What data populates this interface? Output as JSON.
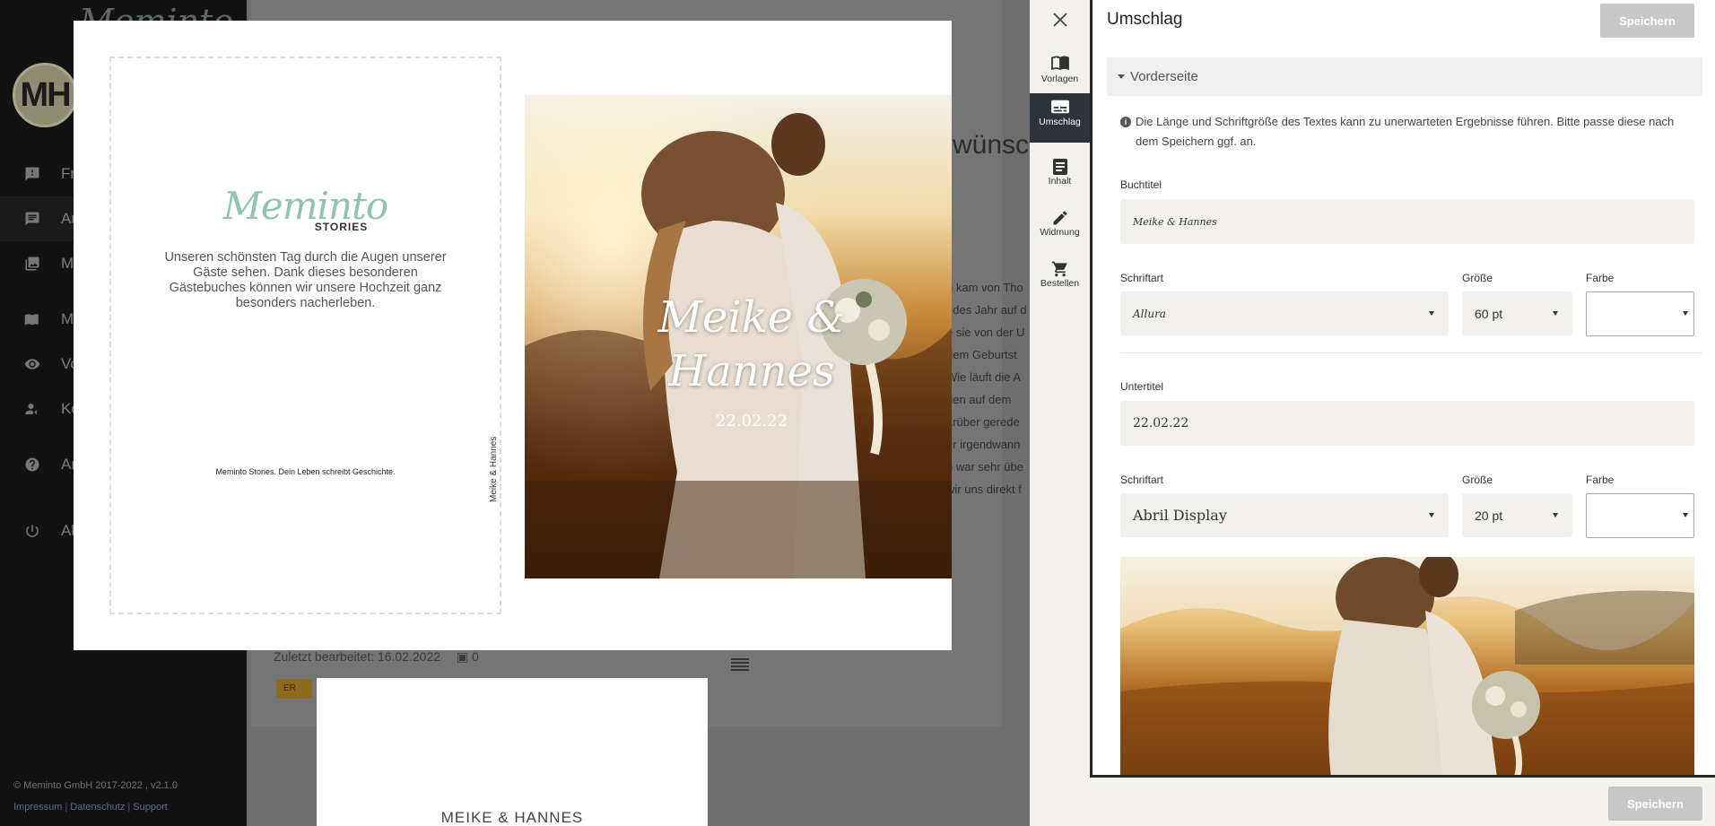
{
  "app_sidebar": {
    "logo_text": "Meminto",
    "avatar_initials": "MH",
    "nav_items": [
      {
        "label": "Fra",
        "icon": "question-feedback-icon"
      },
      {
        "label": "Ant",
        "icon": "chat-icon"
      },
      {
        "label": "Me",
        "icon": "image-icon"
      },
      {
        "label": "Me",
        "icon": "book-icon"
      },
      {
        "label": "Vor",
        "icon": "eye-icon"
      },
      {
        "label": "Kor",
        "icon": "contacts-icon"
      },
      {
        "label": "Anl",
        "icon": "help-circle-icon"
      },
      {
        "label": "Abr",
        "icon": "power-icon"
      }
    ],
    "copyright": "© Meminto GmbH 2017-2022 , v2.1.0",
    "footer_links": [
      "Impressum",
      "Datenschutz",
      "Support"
    ]
  },
  "background_main": {
    "headline": "wünsch",
    "story_lines": [
      "n kam von Tho",
      "edes Jahr auf d",
      "e sie von der U",
      "dem Geburtst",
      "Wie läuft die A",
      "nen auf dem",
      "arüber gerede",
      "er irgendwann",
      "n war sehr übe",
      "wir uns direkt f"
    ],
    "last_edited": "Zuletzt bearbeitet: 16.02.2022",
    "image_count": "0",
    "badge": "ER",
    "page2_title": "MEIKE & HANNES"
  },
  "preview": {
    "back_cover": {
      "brand_script": "Meminto",
      "brand_sub": "STORIES",
      "blurb": "Unseren schönsten Tag durch die Augen unserer Gäste sehen. Dank dieses besonderen Gästebuches können wir unsere Hochzeit ganz besonders nacherleben.",
      "tagline": "Meminto Stories. Dein Leben schreibt Geschichte."
    },
    "spine_text": "Meike & Hannes",
    "front_cover": {
      "title_line1": "Meike &",
      "title_line2": "Hannes",
      "subtitle": "22.02.22"
    }
  },
  "editor": {
    "tools": [
      {
        "label": "Vorlagen",
        "icon": "book-open-icon",
        "active": false
      },
      {
        "label": "Umschlag",
        "icon": "subtitles-icon",
        "active": true
      },
      {
        "label": "Inhalt",
        "icon": "document-icon",
        "active": false
      },
      {
        "label": "Widmung",
        "icon": "pencil-icon",
        "active": false
      },
      {
        "label": "Bestellen",
        "icon": "cart-icon",
        "active": false
      }
    ],
    "panel_title": "Umschlag",
    "save_label": "Speichern",
    "section_label": "Vorderseite",
    "notice": "Die Länge und Schriftgröße des Textes kann zu unerwarteten Ergebnisse führen. Bitte passe diese nach dem Speichern ggf. an.",
    "book_title": {
      "label": "Buchtitel",
      "value": "Meike & Hannes"
    },
    "title_font": {
      "font_label": "Schriftart",
      "font_value": "Allura",
      "size_label": "Größe",
      "size_value": "60 pt",
      "color_label": "Farbe"
    },
    "subtitle": {
      "label": "Untertitel",
      "value": "22.02.22"
    },
    "subtitle_font": {
      "font_label": "Schriftart",
      "font_value": "Abril Display",
      "size_label": "Größe",
      "size_value": "20 pt",
      "color_label": "Farbe"
    }
  },
  "colors": {
    "accent_dark": "#2d3338",
    "brand_teal": "#8ec3b6",
    "button_disabled": "#c7c7c7",
    "field_bg": "#f2f0ec"
  }
}
